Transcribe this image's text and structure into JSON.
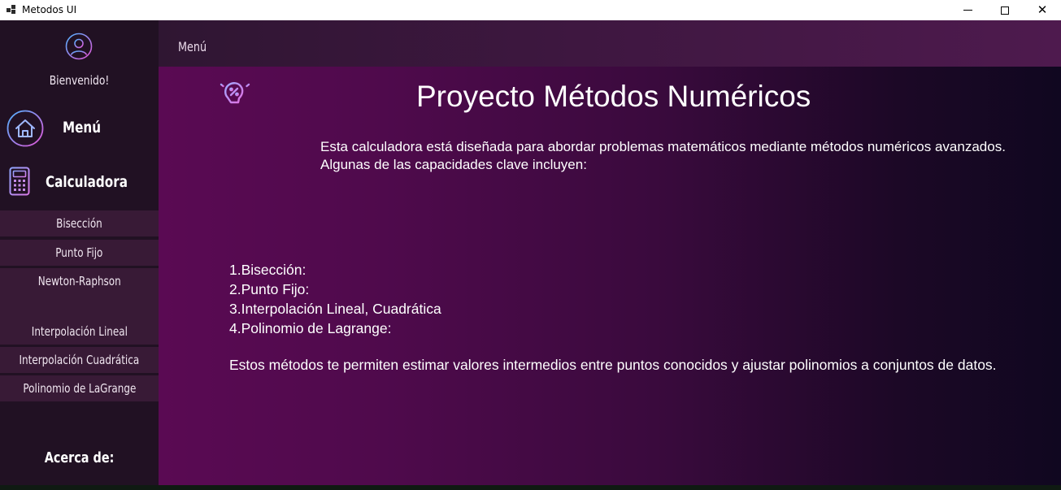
{
  "window": {
    "title": "Metodos UI",
    "icon": "app-icon",
    "controls": [
      "minimize-icon",
      "maximize-icon",
      "close-icon"
    ]
  },
  "sidebar": {
    "welcome": "Bienvenido!",
    "menu_label": "Menú",
    "calc_label": "Calculadora",
    "sub_items": [
      {
        "label": "Bisección"
      },
      {
        "label": "Punto Fijo"
      },
      {
        "label": "Newton-Raphson"
      },
      {
        "label": "Interpolación Lineal"
      },
      {
        "label": "Interpolación Cuadrática"
      },
      {
        "label": "Polinomio de LaGrange"
      }
    ],
    "about_label": "Acerca de:"
  },
  "header": {
    "title": "Menú"
  },
  "main": {
    "title": "Proyecto Métodos Numéricos",
    "intro_line1": "Esta calculadora está diseñada para abordar problemas matemáticos mediante métodos numéricos avanzados.",
    "intro_line2": "Algunas de las capacidades clave incluyen:",
    "methods": [
      "1.Bisección:",
      "2.Punto Fijo:",
      "3.Interpolación Lineal, Cuadrática",
      "4.Polinomio de Lagrange:"
    ],
    "closing": "Estos métodos te permiten estimar valores intermedios entre puntos conocidos y ajustar polinomios a conjuntos de datos."
  },
  "colors": {
    "sidebar_bg": "#211123",
    "sub_item_bg": "#381a36",
    "accent_purple": "#b06ad8",
    "icon_gradient_start": "#4fb3ff",
    "icon_gradient_end": "#e255d6"
  }
}
